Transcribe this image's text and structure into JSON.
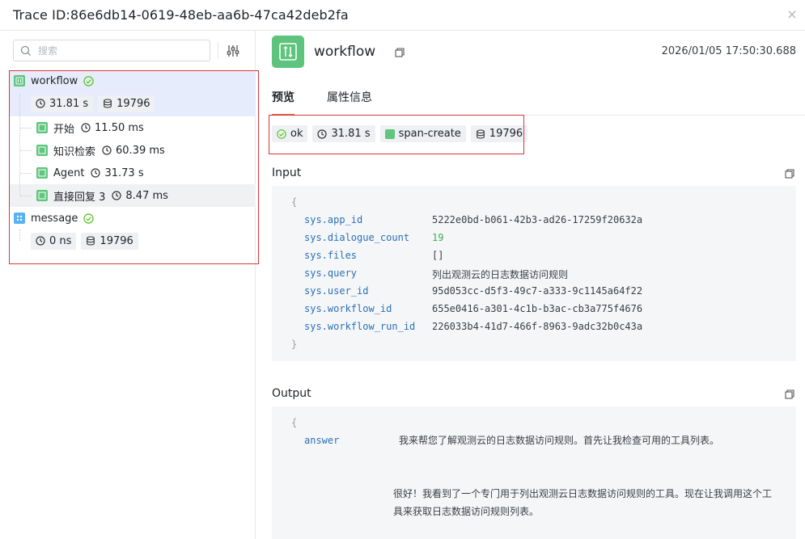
{
  "header": {
    "title": "Trace ID:86e6db14-0619-48eb-aa6b-47ca42deb2fa",
    "close_glyph": "×"
  },
  "sidebar": {
    "search_placeholder": "搜索",
    "tree": [
      {
        "name": "workflow",
        "icon": "workflow-node-icon",
        "status": "ok",
        "duration": "31.81 s",
        "tokens": "19796"
      },
      {
        "name": "开始",
        "icon": "node-icon",
        "duration": "11.50 ms"
      },
      {
        "name": "知识检索",
        "icon": "node-icon",
        "duration": "60.39 ms"
      },
      {
        "name": "Agent",
        "icon": "node-icon",
        "duration": "31.73 s"
      },
      {
        "name": "直接回复 3",
        "icon": "node-icon",
        "duration": "8.47 ms"
      },
      {
        "name": "message",
        "icon": "message-node-icon",
        "status": "ok",
        "duration": "0 ns",
        "tokens": "19796"
      }
    ]
  },
  "detail": {
    "title": "workflow",
    "timestamp": "2026/01/05 17:50:30.688",
    "tabs": [
      "预览",
      "属性信息"
    ],
    "status_tags": {
      "status": "ok",
      "duration": "31.81 s",
      "type": "span-create",
      "tokens": "19796"
    },
    "input": {
      "label": "Input",
      "open_brace": "{",
      "close_brace": "}",
      "fields": [
        {
          "key": "sys.app_id",
          "value": "5222e0bd-b061-42b3-ad26-17259f20632a"
        },
        {
          "key": "sys.dialogue_count",
          "value": "19"
        },
        {
          "key": "sys.files",
          "value": "[]"
        },
        {
          "key": "sys.query",
          "value": "列出观测云的日志数据访问规则"
        },
        {
          "key": "sys.user_id",
          "value": "95d053cc-d5f3-49c7-a333-9c1145a64f22"
        },
        {
          "key": "sys.workflow_id",
          "value": "655e0416-a301-4c1b-b3ac-cb3a775f4676"
        },
        {
          "key": "sys.workflow_run_id",
          "value": "226033b4-41d7-466f-8963-9adc32b0c43a"
        }
      ]
    },
    "output": {
      "label": "Output",
      "open_brace": "{",
      "key": "answer",
      "line1": "我来帮您了解观测云的日志数据访问规则。首先让我检查可用的工具列表。",
      "line2": "很好！我看到了一个专门用于列出观测云日志数据访问规则的工具。现在让我调用这个工",
      "line3": "具来获取日志数据访问规则列表。"
    }
  },
  "colors": {
    "accent": "#e8603c",
    "node_green": "#5fc67d",
    "node_blue": "#57b3f5",
    "ok_green": "#52c41a",
    "highlight_red": "#d9363e",
    "selected_row": "#e6ecfb",
    "hover_row": "#f0f1f3"
  }
}
